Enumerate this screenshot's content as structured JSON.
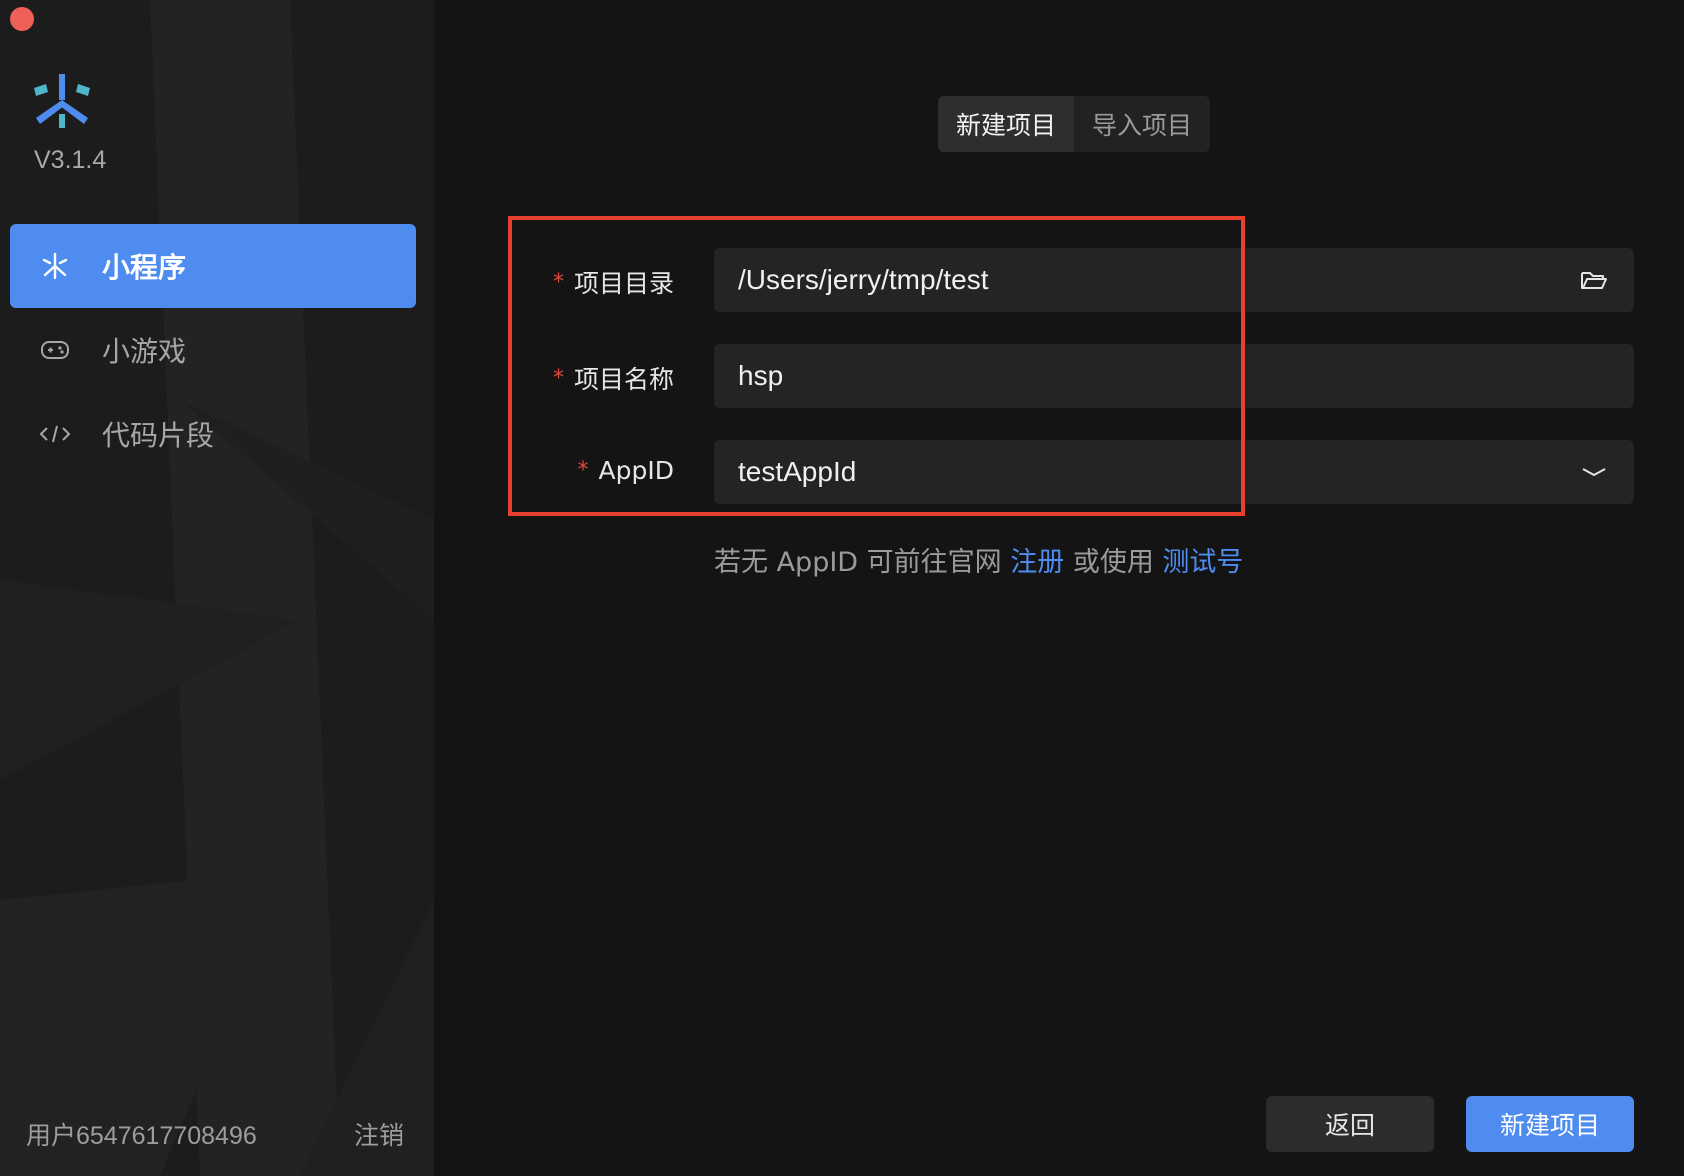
{
  "app": {
    "version": "V3.1.4"
  },
  "sidebar": {
    "items": [
      {
        "label": "小程序",
        "icon": "mini-program-icon",
        "active": true
      },
      {
        "label": "小游戏",
        "icon": "gamepad-icon",
        "active": false
      },
      {
        "label": "代码片段",
        "icon": "code-icon",
        "active": false
      }
    ],
    "user": "用户6547617708496",
    "logout_label": "注销"
  },
  "tabs": [
    {
      "label": "新建项目",
      "active": true
    },
    {
      "label": "导入项目",
      "active": false
    }
  ],
  "form": {
    "required_mark": "*",
    "directory": {
      "label": "项目目录",
      "value": "/Users/jerry/tmp/test",
      "icon": "folder-open-icon"
    },
    "name": {
      "label": "项目名称",
      "value": "hsp"
    },
    "appid": {
      "label": "AppID",
      "value": "testAppId",
      "icon": "chevron-down-icon"
    }
  },
  "hint": {
    "prefix": "若无 AppID 可前往官网 ",
    "register_link": "注册",
    "middle": " 或使用 ",
    "test_link": "测试号"
  },
  "actions": {
    "back_label": "返回",
    "create_label": "新建项目"
  },
  "colors": {
    "accent": "#4e8cf0",
    "required": "#e04b3f",
    "highlight_border": "#e8402f",
    "close_button": "#ee5f57"
  }
}
